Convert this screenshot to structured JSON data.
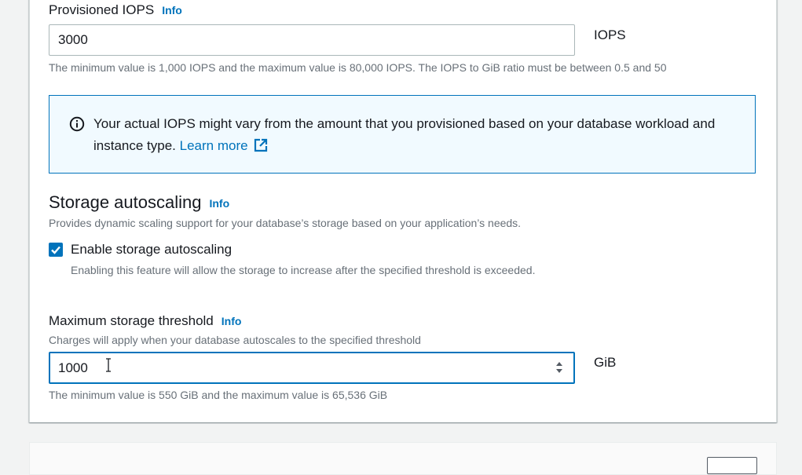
{
  "iops": {
    "label": "Provisioned IOPS",
    "info": "Info",
    "value": "3000",
    "unit": "IOPS",
    "hint": "The minimum value is 1,000 IOPS and the maximum value is 80,000 IOPS. The IOPS to GiB ratio must be between 0.5 and 50"
  },
  "alert": {
    "text": "Your actual IOPS might vary from the amount that you provisioned based on your database workload and instance type.",
    "link": "Learn more",
    "color": "#0073bb"
  },
  "autoscaling": {
    "heading": "Storage autoscaling",
    "info": "Info",
    "description": "Provides dynamic scaling support for your database’s storage based on your application’s needs.",
    "checkbox_label": "Enable storage autoscaling",
    "checkbox_checked": true,
    "checkbox_description": "Enabling this feature will allow the storage to increase after the specified threshold is exceeded."
  },
  "threshold": {
    "label": "Maximum storage threshold",
    "info": "Info",
    "description": "Charges will apply when your database autoscales to the specified threshold",
    "value": "1000",
    "unit": "GiB",
    "hint": "The minimum value is 550 GiB and the maximum value is 65,536 GiB"
  },
  "colors": {
    "accent": "#0073bb",
    "hint_text": "#687078",
    "alert_bg": "#f1faff"
  }
}
